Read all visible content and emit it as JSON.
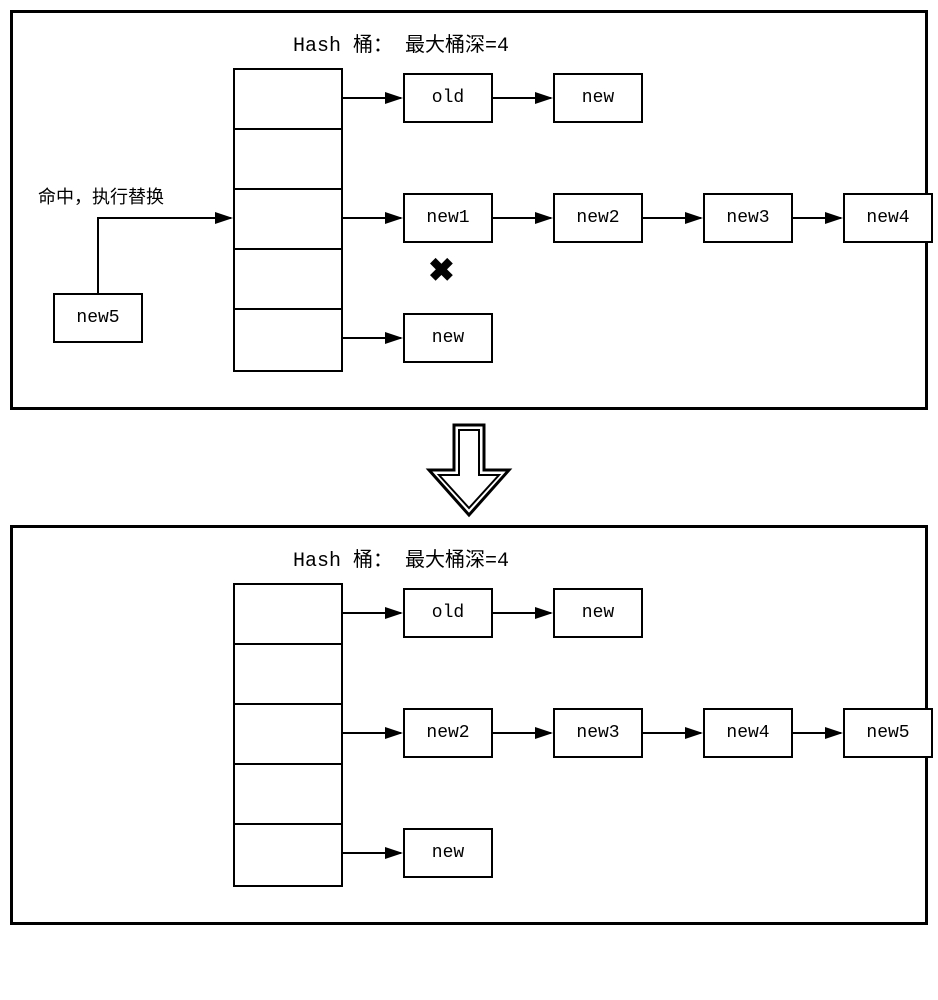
{
  "top": {
    "title": "Hash 桶：  最大桶深=4",
    "hit_label": "命中，执行替换",
    "incoming_node": "new5",
    "rows": {
      "r0": {
        "n0": "old",
        "n1": "new"
      },
      "r2": {
        "n0": "new1",
        "n1": "new2",
        "n2": "new3",
        "n3": "new4"
      },
      "r4": {
        "n0": "new"
      }
    },
    "x_mark": "✖"
  },
  "bottom": {
    "title": "Hash 桶：  最大桶深=4",
    "rows": {
      "r0": {
        "n0": "old",
        "n1": "new"
      },
      "r2": {
        "n0": "new2",
        "n1": "new3",
        "n2": "new4",
        "n3": "new5"
      },
      "r4": {
        "n0": "new"
      }
    }
  }
}
